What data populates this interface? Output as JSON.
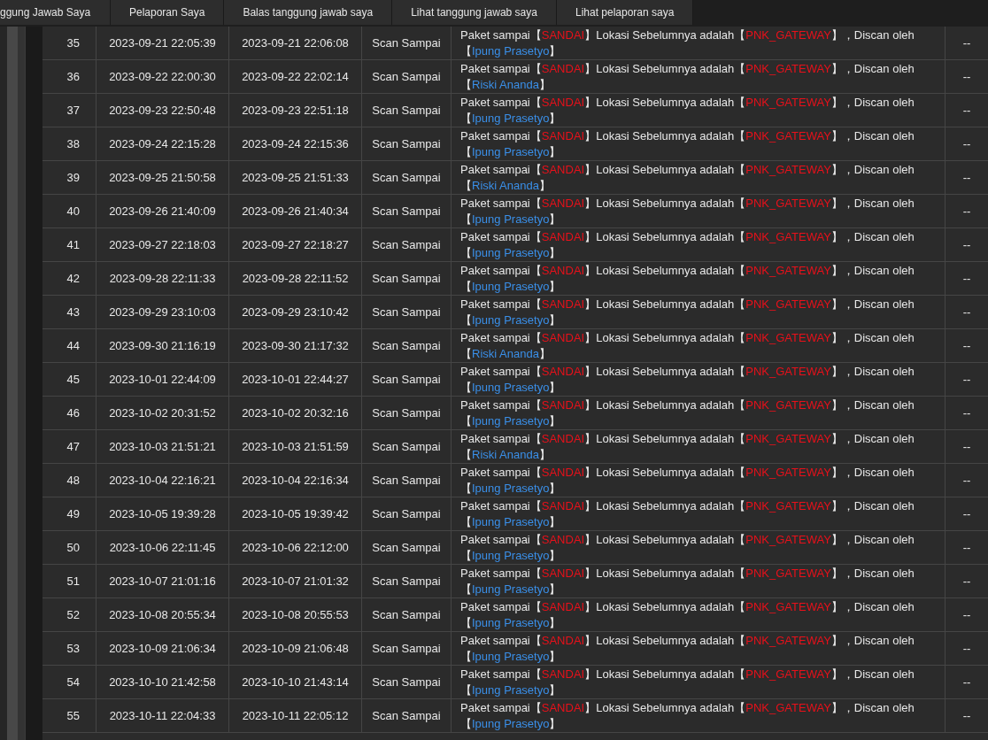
{
  "tabs": [
    {
      "label": "ggung Jawab Saya"
    },
    {
      "label": "Pelaporan Saya"
    },
    {
      "label": "Balas tanggung jawab saya"
    },
    {
      "label": "Lihat tanggung jawab saya"
    },
    {
      "label": "Lihat pelaporan saya"
    }
  ],
  "table": {
    "rows": [
      {
        "no": "35",
        "start": "2023-09-21 22:05:39",
        "end": "2023-09-21 22:06:08",
        "status": "Scan Sampai",
        "description": {
          "line_1": [
            {
              "kind": "plain",
              "text": "Paket sampai【"
            },
            {
              "kind": "place",
              "text": "SANDAI"
            },
            {
              "kind": "plain",
              "text": "】Lokasi Sebelumnya adalah【"
            },
            {
              "kind": "place",
              "text": "PNK_GATEWAY"
            },
            {
              "kind": "plain",
              "text": "】，Discan oleh"
            }
          ],
          "line_2": [
            {
              "kind": "plain",
              "text": "【"
            },
            {
              "kind": "person",
              "text": "Ipung Prasetyo"
            },
            {
              "kind": "plain",
              "text": "】"
            }
          ]
        },
        "column_6": "--"
      },
      {
        "no": "36",
        "start": "2023-09-22 22:00:30",
        "end": "2023-09-22 22:02:14",
        "status": "Scan Sampai",
        "description": {
          "line_1": [
            {
              "kind": "plain",
              "text": "Paket sampai【"
            },
            {
              "kind": "place",
              "text": "SANDAI"
            },
            {
              "kind": "plain",
              "text": "】Lokasi Sebelumnya adalah【"
            },
            {
              "kind": "place",
              "text": "PNK_GATEWAY"
            },
            {
              "kind": "plain",
              "text": "】，Discan oleh"
            }
          ],
          "line_2": [
            {
              "kind": "plain",
              "text": "【"
            },
            {
              "kind": "person",
              "text": "Riski Ananda"
            },
            {
              "kind": "plain",
              "text": "】"
            }
          ]
        },
        "column_6": "--"
      },
      {
        "no": "37",
        "start": "2023-09-23 22:50:48",
        "end": "2023-09-23 22:51:18",
        "status": "Scan Sampai",
        "description": {
          "line_1": [
            {
              "kind": "plain",
              "text": "Paket sampai【"
            },
            {
              "kind": "place",
              "text": "SANDAI"
            },
            {
              "kind": "plain",
              "text": "】Lokasi Sebelumnya adalah【"
            },
            {
              "kind": "place",
              "text": "PNK_GATEWAY"
            },
            {
              "kind": "plain",
              "text": "】，Discan oleh"
            }
          ],
          "line_2": [
            {
              "kind": "plain",
              "text": "【"
            },
            {
              "kind": "person",
              "text": "Ipung Prasetyo"
            },
            {
              "kind": "plain",
              "text": "】"
            }
          ]
        },
        "column_6": "--"
      },
      {
        "no": "38",
        "start": "2023-09-24 22:15:28",
        "end": "2023-09-24 22:15:36",
        "status": "Scan Sampai",
        "description": {
          "line_1": [
            {
              "kind": "plain",
              "text": "Paket sampai【"
            },
            {
              "kind": "place",
              "text": "SANDAI"
            },
            {
              "kind": "plain",
              "text": "】Lokasi Sebelumnya adalah【"
            },
            {
              "kind": "place",
              "text": "PNK_GATEWAY"
            },
            {
              "kind": "plain",
              "text": "】，Discan oleh"
            }
          ],
          "line_2": [
            {
              "kind": "plain",
              "text": "【"
            },
            {
              "kind": "person",
              "text": "Ipung Prasetyo"
            },
            {
              "kind": "plain",
              "text": "】"
            }
          ]
        },
        "column_6": "--"
      },
      {
        "no": "39",
        "start": "2023-09-25 21:50:58",
        "end": "2023-09-25 21:51:33",
        "status": "Scan Sampai",
        "description": {
          "line_1": [
            {
              "kind": "plain",
              "text": "Paket sampai【"
            },
            {
              "kind": "place",
              "text": "SANDAI"
            },
            {
              "kind": "plain",
              "text": "】Lokasi Sebelumnya adalah【"
            },
            {
              "kind": "place",
              "text": "PNK_GATEWAY"
            },
            {
              "kind": "plain",
              "text": "】，Discan oleh"
            }
          ],
          "line_2": [
            {
              "kind": "plain",
              "text": "【"
            },
            {
              "kind": "person",
              "text": "Riski Ananda"
            },
            {
              "kind": "plain",
              "text": "】"
            }
          ]
        },
        "column_6": "--"
      },
      {
        "no": "40",
        "start": "2023-09-26 21:40:09",
        "end": "2023-09-26 21:40:34",
        "status": "Scan Sampai",
        "description": {
          "line_1": [
            {
              "kind": "plain",
              "text": "Paket sampai【"
            },
            {
              "kind": "place",
              "text": "SANDAI"
            },
            {
              "kind": "plain",
              "text": "】Lokasi Sebelumnya adalah【"
            },
            {
              "kind": "place",
              "text": "PNK_GATEWAY"
            },
            {
              "kind": "plain",
              "text": "】，Discan oleh"
            }
          ],
          "line_2": [
            {
              "kind": "plain",
              "text": "【"
            },
            {
              "kind": "person",
              "text": "Ipung Prasetyo"
            },
            {
              "kind": "plain",
              "text": "】"
            }
          ]
        },
        "column_6": "--"
      },
      {
        "no": "41",
        "start": "2023-09-27 22:18:03",
        "end": "2023-09-27 22:18:27",
        "status": "Scan Sampai",
        "description": {
          "line_1": [
            {
              "kind": "plain",
              "text": "Paket sampai【"
            },
            {
              "kind": "place",
              "text": "SANDAI"
            },
            {
              "kind": "plain",
              "text": "】Lokasi Sebelumnya adalah【"
            },
            {
              "kind": "place",
              "text": "PNK_GATEWAY"
            },
            {
              "kind": "plain",
              "text": "】，Discan oleh"
            }
          ],
          "line_2": [
            {
              "kind": "plain",
              "text": "【"
            },
            {
              "kind": "person",
              "text": "Ipung Prasetyo"
            },
            {
              "kind": "plain",
              "text": "】"
            }
          ]
        },
        "column_6": "--"
      },
      {
        "no": "42",
        "start": "2023-09-28 22:11:33",
        "end": "2023-09-28 22:11:52",
        "status": "Scan Sampai",
        "description": {
          "line_1": [
            {
              "kind": "plain",
              "text": "Paket sampai【"
            },
            {
              "kind": "place",
              "text": "SANDAI"
            },
            {
              "kind": "plain",
              "text": "】Lokasi Sebelumnya adalah【"
            },
            {
              "kind": "place",
              "text": "PNK_GATEWAY"
            },
            {
              "kind": "plain",
              "text": "】，Discan oleh"
            }
          ],
          "line_2": [
            {
              "kind": "plain",
              "text": "【"
            },
            {
              "kind": "person",
              "text": "Ipung Prasetyo"
            },
            {
              "kind": "plain",
              "text": "】"
            }
          ]
        },
        "column_6": "--"
      },
      {
        "no": "43",
        "start": "2023-09-29 23:10:03",
        "end": "2023-09-29 23:10:42",
        "status": "Scan Sampai",
        "description": {
          "line_1": [
            {
              "kind": "plain",
              "text": "Paket sampai【"
            },
            {
              "kind": "place",
              "text": "SANDAI"
            },
            {
              "kind": "plain",
              "text": "】Lokasi Sebelumnya adalah【"
            },
            {
              "kind": "place",
              "text": "PNK_GATEWAY"
            },
            {
              "kind": "plain",
              "text": "】，Discan oleh"
            }
          ],
          "line_2": [
            {
              "kind": "plain",
              "text": "【"
            },
            {
              "kind": "person",
              "text": "Ipung Prasetyo"
            },
            {
              "kind": "plain",
              "text": "】"
            }
          ]
        },
        "column_6": "--"
      },
      {
        "no": "44",
        "start": "2023-09-30 21:16:19",
        "end": "2023-09-30 21:17:32",
        "status": "Scan Sampai",
        "description": {
          "line_1": [
            {
              "kind": "plain",
              "text": "Paket sampai【"
            },
            {
              "kind": "place",
              "text": "SANDAI"
            },
            {
              "kind": "plain",
              "text": "】Lokasi Sebelumnya adalah【"
            },
            {
              "kind": "place",
              "text": "PNK_GATEWAY"
            },
            {
              "kind": "plain",
              "text": "】，Discan oleh"
            }
          ],
          "line_2": [
            {
              "kind": "plain",
              "text": "【"
            },
            {
              "kind": "person",
              "text": "Riski Ananda"
            },
            {
              "kind": "plain",
              "text": "】"
            }
          ]
        },
        "column_6": "--"
      },
      {
        "no": "45",
        "start": "2023-10-01 22:44:09",
        "end": "2023-10-01 22:44:27",
        "status": "Scan Sampai",
        "description": {
          "line_1": [
            {
              "kind": "plain",
              "text": "Paket sampai【"
            },
            {
              "kind": "place",
              "text": "SANDAI"
            },
            {
              "kind": "plain",
              "text": "】Lokasi Sebelumnya adalah【"
            },
            {
              "kind": "place",
              "text": "PNK_GATEWAY"
            },
            {
              "kind": "plain",
              "text": "】，Discan oleh"
            }
          ],
          "line_2": [
            {
              "kind": "plain",
              "text": "【"
            },
            {
              "kind": "person",
              "text": "Ipung Prasetyo"
            },
            {
              "kind": "plain",
              "text": "】"
            }
          ]
        },
        "column_6": "--"
      },
      {
        "no": "46",
        "start": "2023-10-02 20:31:52",
        "end": "2023-10-02 20:32:16",
        "status": "Scan Sampai",
        "description": {
          "line_1": [
            {
              "kind": "plain",
              "text": "Paket sampai【"
            },
            {
              "kind": "place",
              "text": "SANDAI"
            },
            {
              "kind": "plain",
              "text": "】Lokasi Sebelumnya adalah【"
            },
            {
              "kind": "place",
              "text": "PNK_GATEWAY"
            },
            {
              "kind": "plain",
              "text": "】，Discan oleh"
            }
          ],
          "line_2": [
            {
              "kind": "plain",
              "text": "【"
            },
            {
              "kind": "person",
              "text": "Ipung Prasetyo"
            },
            {
              "kind": "plain",
              "text": "】"
            }
          ]
        },
        "column_6": "--"
      },
      {
        "no": "47",
        "start": "2023-10-03 21:51:21",
        "end": "2023-10-03 21:51:59",
        "status": "Scan Sampai",
        "description": {
          "line_1": [
            {
              "kind": "plain",
              "text": "Paket sampai【"
            },
            {
              "kind": "place",
              "text": "SANDAI"
            },
            {
              "kind": "plain",
              "text": "】Lokasi Sebelumnya adalah【"
            },
            {
              "kind": "place",
              "text": "PNK_GATEWAY"
            },
            {
              "kind": "plain",
              "text": "】，Discan oleh"
            }
          ],
          "line_2": [
            {
              "kind": "plain",
              "text": "【"
            },
            {
              "kind": "person",
              "text": "Riski Ananda"
            },
            {
              "kind": "plain",
              "text": "】"
            }
          ]
        },
        "column_6": "--"
      },
      {
        "no": "48",
        "start": "2023-10-04 22:16:21",
        "end": "2023-10-04 22:16:34",
        "status": "Scan Sampai",
        "description": {
          "line_1": [
            {
              "kind": "plain",
              "text": "Paket sampai【"
            },
            {
              "kind": "place",
              "text": "SANDAI"
            },
            {
              "kind": "plain",
              "text": "】Lokasi Sebelumnya adalah【"
            },
            {
              "kind": "place",
              "text": "PNK_GATEWAY"
            },
            {
              "kind": "plain",
              "text": "】，Discan oleh"
            }
          ],
          "line_2": [
            {
              "kind": "plain",
              "text": "【"
            },
            {
              "kind": "person",
              "text": "Ipung Prasetyo"
            },
            {
              "kind": "plain",
              "text": "】"
            }
          ]
        },
        "column_6": "--"
      },
      {
        "no": "49",
        "start": "2023-10-05 19:39:28",
        "end": "2023-10-05 19:39:42",
        "status": "Scan Sampai",
        "description": {
          "line_1": [
            {
              "kind": "plain",
              "text": "Paket sampai【"
            },
            {
              "kind": "place",
              "text": "SANDAI"
            },
            {
              "kind": "plain",
              "text": "】Lokasi Sebelumnya adalah【"
            },
            {
              "kind": "place",
              "text": "PNK_GATEWAY"
            },
            {
              "kind": "plain",
              "text": "】，Discan oleh"
            }
          ],
          "line_2": [
            {
              "kind": "plain",
              "text": "【"
            },
            {
              "kind": "person",
              "text": "Ipung Prasetyo"
            },
            {
              "kind": "plain",
              "text": "】"
            }
          ]
        },
        "column_6": "--"
      },
      {
        "no": "50",
        "start": "2023-10-06 22:11:45",
        "end": "2023-10-06 22:12:00",
        "status": "Scan Sampai",
        "description": {
          "line_1": [
            {
              "kind": "plain",
              "text": "Paket sampai【"
            },
            {
              "kind": "place",
              "text": "SANDAI"
            },
            {
              "kind": "plain",
              "text": "】Lokasi Sebelumnya adalah【"
            },
            {
              "kind": "place",
              "text": "PNK_GATEWAY"
            },
            {
              "kind": "plain",
              "text": "】，Discan oleh"
            }
          ],
          "line_2": [
            {
              "kind": "plain",
              "text": "【"
            },
            {
              "kind": "person",
              "text": "Ipung Prasetyo"
            },
            {
              "kind": "plain",
              "text": "】"
            }
          ]
        },
        "column_6": "--"
      },
      {
        "no": "51",
        "start": "2023-10-07 21:01:16",
        "end": "2023-10-07 21:01:32",
        "status": "Scan Sampai",
        "description": {
          "line_1": [
            {
              "kind": "plain",
              "text": "Paket sampai【"
            },
            {
              "kind": "place",
              "text": "SANDAI"
            },
            {
              "kind": "plain",
              "text": "】Lokasi Sebelumnya adalah【"
            },
            {
              "kind": "place",
              "text": "PNK_GATEWAY"
            },
            {
              "kind": "plain",
              "text": "】，Discan oleh"
            }
          ],
          "line_2": [
            {
              "kind": "plain",
              "text": "【"
            },
            {
              "kind": "person",
              "text": "Ipung Prasetyo"
            },
            {
              "kind": "plain",
              "text": "】"
            }
          ]
        },
        "column_6": "--"
      },
      {
        "no": "52",
        "start": "2023-10-08 20:55:34",
        "end": "2023-10-08 20:55:53",
        "status": "Scan Sampai",
        "description": {
          "line_1": [
            {
              "kind": "plain",
              "text": "Paket sampai【"
            },
            {
              "kind": "place",
              "text": "SANDAI"
            },
            {
              "kind": "plain",
              "text": "】Lokasi Sebelumnya adalah【"
            },
            {
              "kind": "place",
              "text": "PNK_GATEWAY"
            },
            {
              "kind": "plain",
              "text": "】，Discan oleh"
            }
          ],
          "line_2": [
            {
              "kind": "plain",
              "text": "【"
            },
            {
              "kind": "person",
              "text": "Ipung Prasetyo"
            },
            {
              "kind": "plain",
              "text": "】"
            }
          ]
        },
        "column_6": "--"
      },
      {
        "no": "53",
        "start": "2023-10-09 21:06:34",
        "end": "2023-10-09 21:06:48",
        "status": "Scan Sampai",
        "description": {
          "line_1": [
            {
              "kind": "plain",
              "text": "Paket sampai【"
            },
            {
              "kind": "place",
              "text": "SANDAI"
            },
            {
              "kind": "plain",
              "text": "】Lokasi Sebelumnya adalah【"
            },
            {
              "kind": "place",
              "text": "PNK_GATEWAY"
            },
            {
              "kind": "plain",
              "text": "】，Discan oleh"
            }
          ],
          "line_2": [
            {
              "kind": "plain",
              "text": "【"
            },
            {
              "kind": "person",
              "text": "Ipung Prasetyo"
            },
            {
              "kind": "plain",
              "text": "】"
            }
          ]
        },
        "column_6": "--"
      },
      {
        "no": "54",
        "start": "2023-10-10 21:42:58",
        "end": "2023-10-10 21:43:14",
        "status": "Scan Sampai",
        "description": {
          "line_1": [
            {
              "kind": "plain",
              "text": "Paket sampai【"
            },
            {
              "kind": "place",
              "text": "SANDAI"
            },
            {
              "kind": "plain",
              "text": "】Lokasi Sebelumnya adalah【"
            },
            {
              "kind": "place",
              "text": "PNK_GATEWAY"
            },
            {
              "kind": "plain",
              "text": "】，Discan oleh"
            }
          ],
          "line_2": [
            {
              "kind": "plain",
              "text": "【"
            },
            {
              "kind": "person",
              "text": "Ipung Prasetyo"
            },
            {
              "kind": "plain",
              "text": "】"
            }
          ]
        },
        "column_6": "--"
      },
      {
        "no": "55",
        "start": "2023-10-11 22:04:33",
        "end": "2023-10-11 22:05:12",
        "status": "Scan Sampai",
        "description": {
          "line_1": [
            {
              "kind": "plain",
              "text": "Paket sampai【"
            },
            {
              "kind": "place",
              "text": "SANDAI"
            },
            {
              "kind": "plain",
              "text": "】Lokasi Sebelumnya adalah【"
            },
            {
              "kind": "place",
              "text": "PNK_GATEWAY"
            },
            {
              "kind": "plain",
              "text": "】，Discan oleh"
            }
          ],
          "line_2": [
            {
              "kind": "plain",
              "text": "【"
            },
            {
              "kind": "person",
              "text": "Ipung Prasetyo"
            },
            {
              "kind": "plain",
              "text": "】"
            }
          ]
        },
        "column_6": "--"
      }
    ]
  }
}
